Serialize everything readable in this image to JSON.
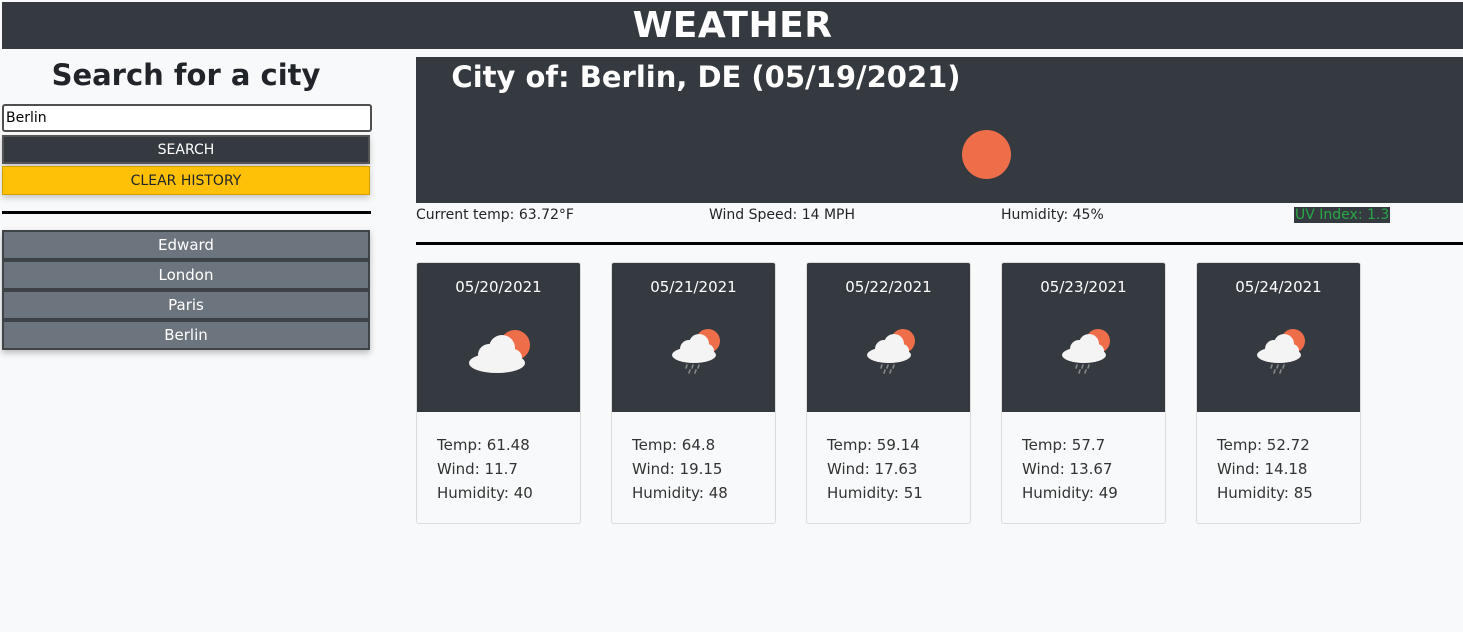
{
  "header": {
    "title": "WEATHER"
  },
  "sidebar": {
    "title": "Search for a city",
    "search": {
      "value": "Berlin",
      "placeholder": ""
    },
    "search_label": "SEARCH",
    "clear_label": "CLEAR HISTORY",
    "history": [
      "Edward",
      "London",
      "Paris",
      "Berlin"
    ]
  },
  "current": {
    "title": "City of: Berlin, DE (05/19/2021)",
    "icon": "sun-icon",
    "temp": "Current temp: 63.72°F",
    "wind": "Wind Speed: 14 MPH",
    "humidity": "Humidity: 45%",
    "uv": "UV Index: 1.3",
    "colors": {
      "panel": "#343a40",
      "sun": "#ee6e4a",
      "uv_text": "#28a745"
    }
  },
  "forecast": [
    {
      "date": "05/20/2021",
      "icon": "cloud-sun-icon",
      "temp": "Temp: 61.48",
      "wind": "Wind: 11.7",
      "humidity": "Humidity: 40"
    },
    {
      "date": "05/21/2021",
      "icon": "rain-cloud-sun-icon",
      "temp": "Temp: 64.8",
      "wind": "Wind: 19.15",
      "humidity": "Humidity: 48"
    },
    {
      "date": "05/22/2021",
      "icon": "rain-cloud-sun-icon",
      "temp": "Temp: 59.14",
      "wind": "Wind: 17.63",
      "humidity": "Humidity: 51"
    },
    {
      "date": "05/23/2021",
      "icon": "rain-cloud-sun-icon",
      "temp": "Temp: 57.7",
      "wind": "Wind: 13.67",
      "humidity": "Humidity: 49"
    },
    {
      "date": "05/24/2021",
      "icon": "rain-cloud-sun-icon",
      "temp": "Temp: 52.72",
      "wind": "Wind: 14.18",
      "humidity": "Humidity: 85"
    }
  ]
}
